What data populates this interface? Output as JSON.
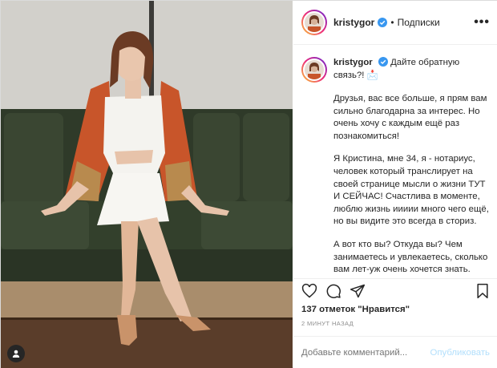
{
  "post": {
    "username": "kristygor",
    "follow_label": "Подписки",
    "dot": "•",
    "more_label": "•••",
    "caption_lead": "Дайте обратную связь?! 📩",
    "paragraphs": [
      "Друзья, вас все больше, я прям вам сильно благодарна за интерес. Но очень хочу с каждым ещё раз познакомиться!",
      "Я Кристина, мне 34, я - нотариус, человек который транслирует на своей странице мысли о жизни ТУТ И СЕЙЧАС! Счастлива в моменте, люблю жизнь иииии много чего ещё, но вы видите это всегда в сториз.",
      "А вот кто вы? Откуда вы? Чем занимаетесь и увлекаетесь, сколько вам лет-уж очень хочется знать."
    ],
    "likes_text": "137 отметок \"Нравится\"",
    "time_text": "2 МИНУТ НАЗАД",
    "comment_placeholder": "Добавьте комментарий...",
    "publish_label": "Опубликовать"
  },
  "icons": {
    "verified": "verified-badge-icon",
    "like": "heart-icon",
    "comment": "comment-icon",
    "share": "paper-plane-icon",
    "save": "bookmark-icon",
    "tags": "user-tag-icon"
  },
  "colors": {
    "verified": "#3897f0",
    "publish_disabled": "#b2dffc",
    "jacket": "#c8552a",
    "sofa": "#3a4632"
  }
}
